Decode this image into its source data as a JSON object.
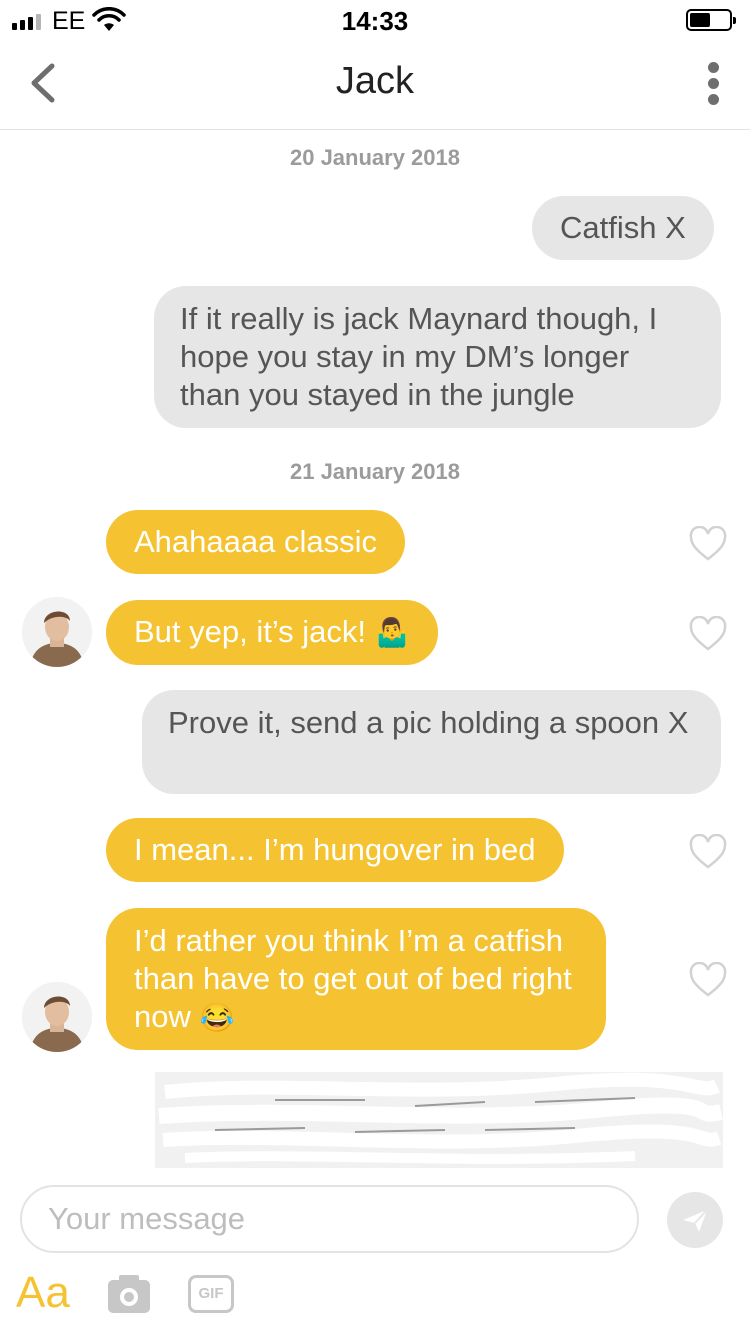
{
  "status_bar": {
    "carrier": "EE",
    "time": "14:33"
  },
  "header": {
    "title": "Jack"
  },
  "conversation": {
    "date_1": "20 January 2018",
    "date_2": "21 January 2018",
    "messages": [
      {
        "side": "sent",
        "text": "Catfish X"
      },
      {
        "side": "sent",
        "text": "If it really is jack Maynard though, I hope you stay in my DM’s longer than you stayed in the jungle"
      },
      {
        "side": "received",
        "text": "Ahahaaaa classic"
      },
      {
        "side": "received",
        "text": "But yep, it’s jack!",
        "emoji": "🤷‍♂️"
      },
      {
        "side": "sent",
        "text": "Prove it, send a pic holding a spoon X"
      },
      {
        "side": "received",
        "text": "I mean... I’m hungover in bed"
      },
      {
        "side": "received",
        "text": "I’d rather you think I’m a catfish than have to get out of bed right now",
        "emoji": "😂"
      }
    ]
  },
  "composer": {
    "placeholder": "Your message",
    "aa_label": "Aa",
    "gif_label": "GIF"
  },
  "colors": {
    "received_bubble": "#f5c331",
    "sent_bubble": "#e6e6e6",
    "accent": "#f5c331"
  },
  "icons": [
    "signal-icon",
    "wifi-icon",
    "battery-icon",
    "back-chevron-icon",
    "more-options-icon",
    "heart-icon",
    "send-icon",
    "camera-icon",
    "gif-icon"
  ]
}
